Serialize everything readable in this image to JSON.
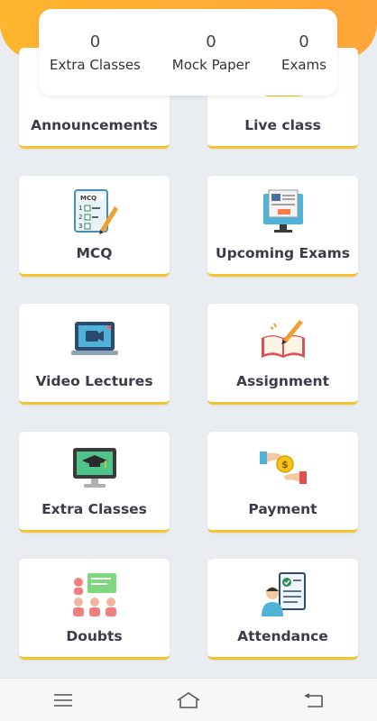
{
  "stats": [
    {
      "value": "0",
      "label": "Extra Classes"
    },
    {
      "value": "0",
      "label": "Mock Paper"
    },
    {
      "value": "0",
      "label": "Exams"
    }
  ],
  "tiles": [
    {
      "label": "Announcements",
      "icon": "megaphone-icon"
    },
    {
      "label": "Live class",
      "icon": "live-class-icon"
    },
    {
      "label": "MCQ",
      "icon": "mcq-icon"
    },
    {
      "label": "Upcoming Exams",
      "icon": "exam-screen-icon"
    },
    {
      "label": "Video Lectures",
      "icon": "video-laptop-icon"
    },
    {
      "label": "Assignment",
      "icon": "book-pencil-icon"
    },
    {
      "label": "Extra Classes",
      "icon": "monitor-graduation-icon"
    },
    {
      "label": "Payment",
      "icon": "payment-coin-icon"
    },
    {
      "label": "Doubts",
      "icon": "doubt-group-icon"
    },
    {
      "label": "Attendance",
      "icon": "attendance-checklist-icon"
    }
  ],
  "nav": {
    "menu": "menu-icon",
    "home": "home-icon",
    "back": "back-icon"
  },
  "colors": {
    "accent": "#ffb52e",
    "tile_border": "#f4c430",
    "background": "#e9edf1"
  }
}
